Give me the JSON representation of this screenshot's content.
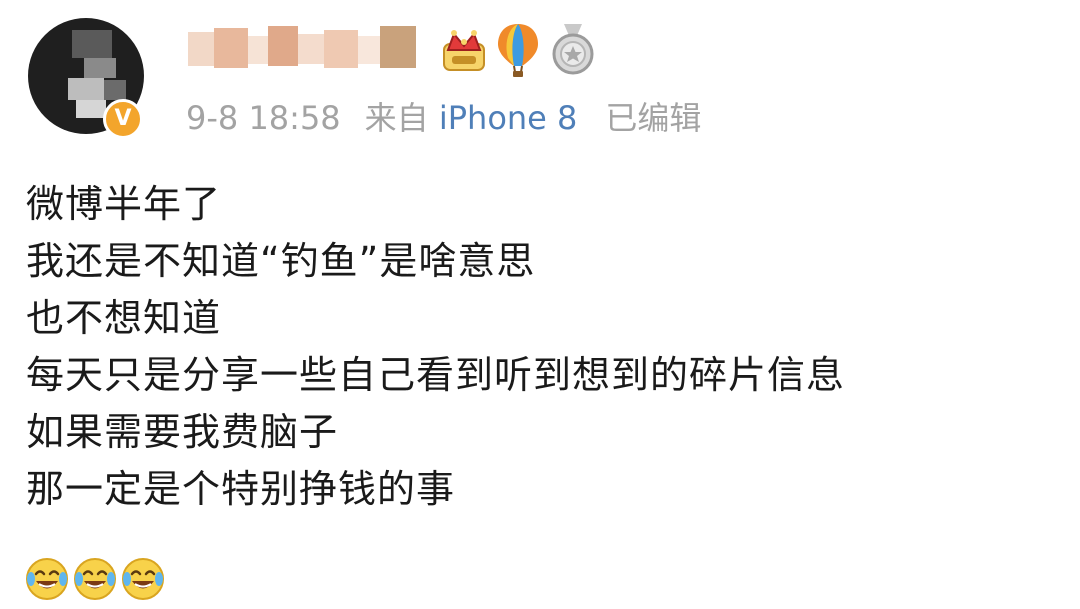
{
  "post": {
    "author": {
      "name": "",
      "verified_badge": "V",
      "badges": [
        "crown-badge-icon",
        "hot-air-balloon-icon",
        "silver-medal-icon"
      ]
    },
    "time": "9-8 18:58",
    "source_prefix": "来自",
    "device": "iPhone 8",
    "edited": "已编辑",
    "lines": [
      "微博半年了",
      "我还是不知道“钓鱼”是啥意思",
      "也不想知道",
      "每天只是分享一些自己看到听到想到的碎片信息",
      "如果需要我费脑子",
      "那一定是个特别挣钱的事"
    ],
    "emojis": [
      "laugh-cry-emoji",
      "laugh-cry-emoji",
      "laugh-cry-emoji"
    ]
  },
  "colors": {
    "text": "#1a1a1a",
    "meta": "#a3a3a3",
    "device": "#4f7fb8",
    "verified": "#f3a52c"
  }
}
